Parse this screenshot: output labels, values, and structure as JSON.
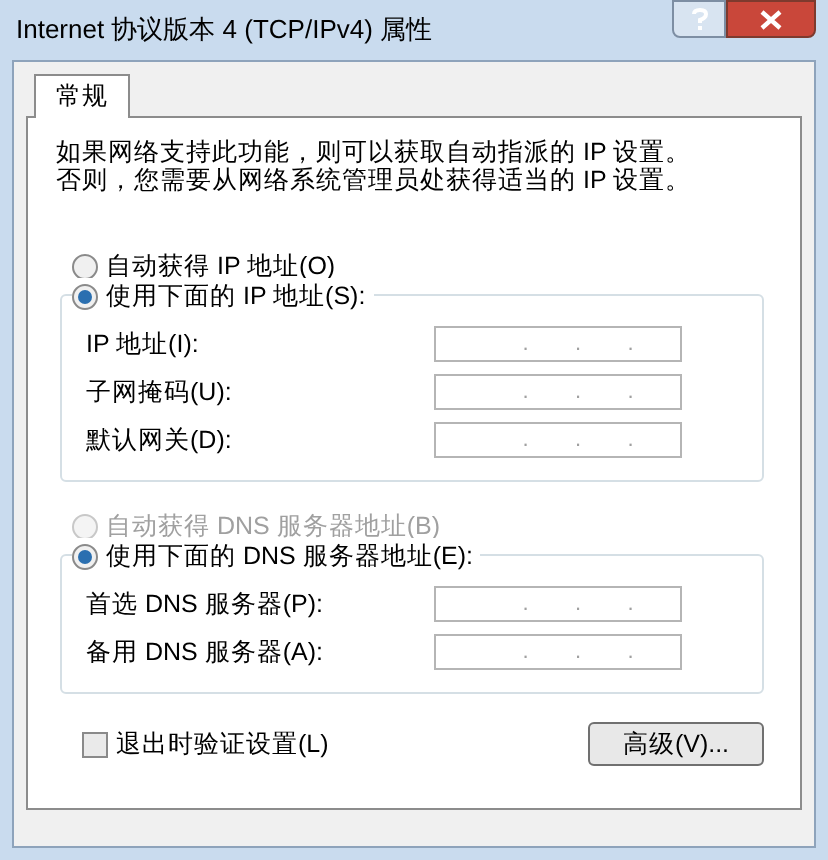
{
  "window": {
    "title": "Internet 协议版本 4 (TCP/IPv4) 属性"
  },
  "tabs": [
    {
      "label": "常规",
      "selected": true
    }
  ],
  "description": "如果网络支持此功能，则可以获取自动指派的 IP 设置。否则，您需要从网络系统管理员处获得适当的 IP 设置。",
  "ip_section": {
    "auto_option": {
      "label": "自动获得 IP 地址(O)",
      "selected": false,
      "disabled": false
    },
    "manual_option": {
      "label": "使用下面的 IP 地址(S):",
      "selected": true,
      "disabled": false
    },
    "fields": [
      {
        "label": "IP 地址(I):",
        "separators": [
          ".",
          ".",
          "."
        ]
      },
      {
        "label": "子网掩码(U):",
        "separators": [
          ".",
          ".",
          "."
        ]
      },
      {
        "label": "默认网关(D):",
        "separators": [
          ".",
          ".",
          "."
        ]
      }
    ]
  },
  "dns_section": {
    "auto_option": {
      "label": "自动获得 DNS 服务器地址(B)",
      "selected": false,
      "disabled": true
    },
    "manual_option": {
      "label": "使用下面的 DNS 服务器地址(E):",
      "selected": true,
      "disabled": false
    },
    "fields": [
      {
        "label": "首选 DNS 服务器(P):",
        "separators": [
          ".",
          ".",
          "."
        ]
      },
      {
        "label": "备用 DNS 服务器(A):",
        "separators": [
          ".",
          ".",
          "."
        ]
      }
    ]
  },
  "validate_checkbox": {
    "label": "退出时验证设置(L)",
    "checked": false
  },
  "advanced_button": {
    "label": "高级(V)..."
  }
}
